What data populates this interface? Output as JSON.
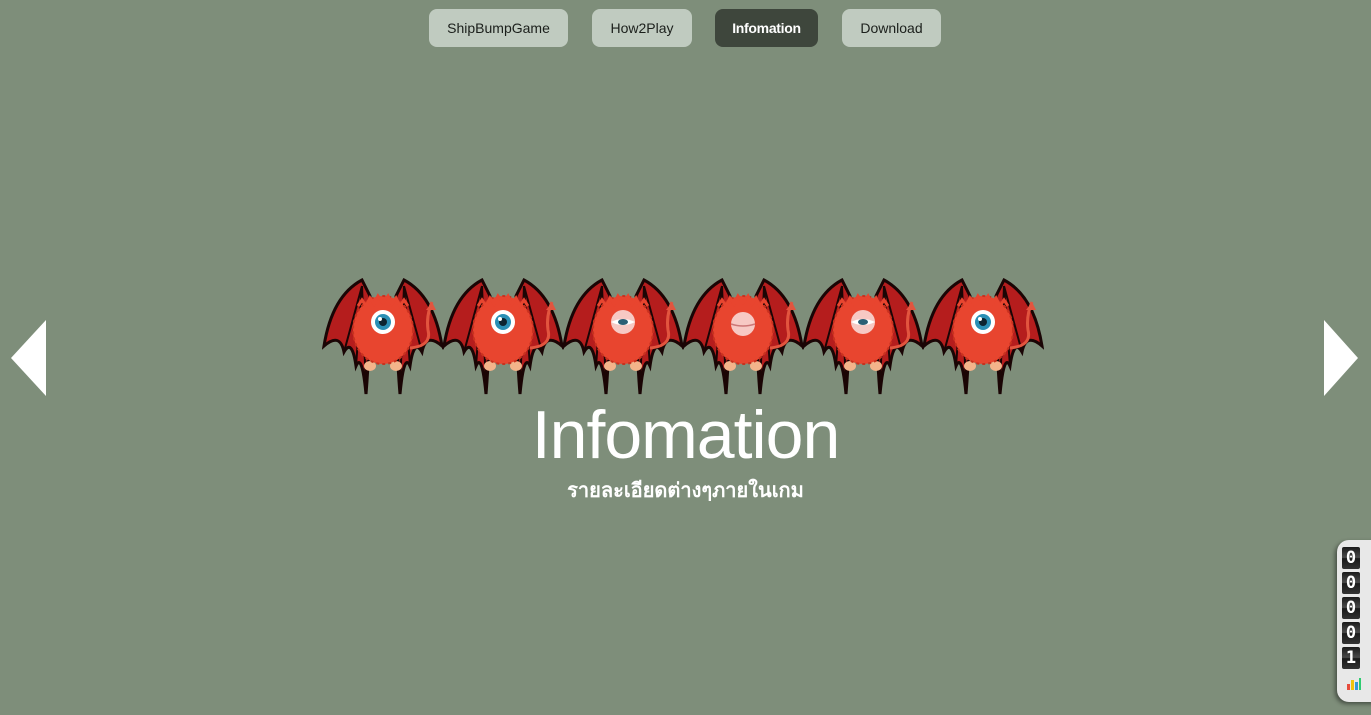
{
  "nav": {
    "items": [
      {
        "label": "ShipBumpGame",
        "active": false
      },
      {
        "label": "How2Play",
        "active": false
      },
      {
        "label": "Infomation",
        "active": true
      },
      {
        "label": "Download",
        "active": false
      }
    ]
  },
  "hero": {
    "title": "Infomation",
    "subtitle": "รายละเอียดต่างๆภายในเกม",
    "monster_eye_states": [
      "open",
      "open",
      "squint",
      "closed",
      "squint",
      "open"
    ]
  },
  "arrows": {
    "prev_icon": "left-triangle-arrow-icon",
    "next_icon": "right-triangle-arrow-icon"
  },
  "counter": {
    "digits": [
      "0",
      "0",
      "0",
      "0",
      "1"
    ],
    "icon": "bar-chart-icon"
  },
  "colors": {
    "background": "#7e8e7a",
    "nav_button": "#c0cbc0",
    "nav_button_active": "#3e463c",
    "monster_fur": "#e8452f",
    "wing": "#b51d1d"
  }
}
